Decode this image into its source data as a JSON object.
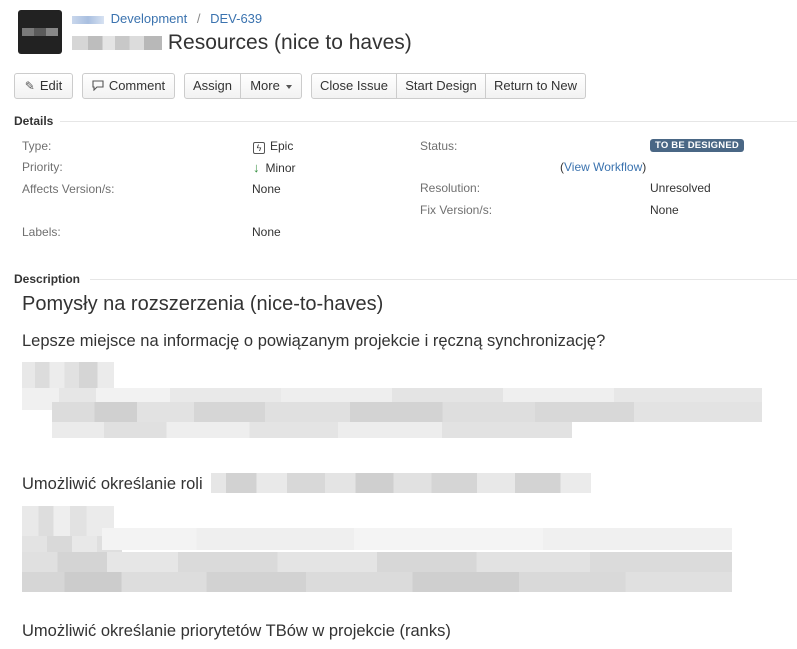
{
  "header": {
    "project_link": "Development",
    "separator": "/",
    "issue_key": "DEV-639",
    "summary": "Resources (nice to haves)"
  },
  "toolbar": {
    "edit_label": "Edit",
    "comment_label": "Comment",
    "assign_label": "Assign",
    "more_label": "More",
    "close_issue_label": "Close Issue",
    "start_design_label": "Start Design",
    "return_to_new_label": "Return to New"
  },
  "details": {
    "section_title": "Details",
    "type_label": "Type:",
    "type_value": "Epic",
    "priority_label": "Priority:",
    "priority_value": "Minor",
    "affects_label": "Affects Version/s:",
    "affects_value": "None",
    "labels_label": "Labels:",
    "labels_value": "None",
    "status_label": "Status:",
    "status_value": "TO BE DESIGNED",
    "view_workflow_open": "(",
    "view_workflow_link": "View Workflow",
    "view_workflow_close": ")",
    "resolution_label": "Resolution:",
    "resolution_value": "Unresolved",
    "fix_label": "Fix Version/s:",
    "fix_value": "None"
  },
  "description": {
    "section_title": "Description",
    "heading": "Pomysły na rozszerzenia (nice-to-haves)",
    "item1": "Lepsze miejsce na informację o powiązanym projekcie i ręczną synchronizację?",
    "item2": "Umożliwić określanie roli",
    "item3": "Umożliwić określanie priorytetów TBów w projekcie (ranks)"
  },
  "colors": {
    "link": "#3b73af",
    "status_badge_bg": "#4a6785",
    "minor_arrow": "#2f8d3a"
  },
  "icons": {
    "edit": "pencil-icon",
    "comment": "speech-bubble-icon",
    "type": "epic-lightning-icon",
    "priority": "arrow-down-icon"
  }
}
